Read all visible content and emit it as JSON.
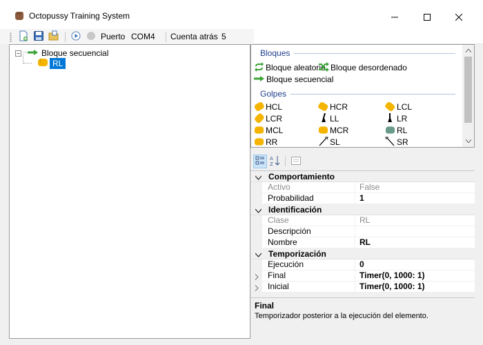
{
  "window": {
    "title": "Octopussy Training System",
    "minimize_glyph": "—",
    "maximize_glyph": "☐",
    "close_glyph": "✕"
  },
  "toolbar": {
    "new_icon": "new-document-icon",
    "save_icon": "save-icon",
    "open_icon": "open-folder-icon",
    "play_icon": "play-icon",
    "status_icon": "status-dot-icon",
    "port_label": "Puerto",
    "port_value": "COM4",
    "countdown_label": "Cuenta atrás",
    "countdown_value": "5"
  },
  "tree": {
    "root_expander": "−",
    "root_label": "Bloque secuencial",
    "child_label": "RL"
  },
  "toolbox": {
    "bloques_header": "Bloques",
    "bloques": [
      {
        "label": "Bloque aleatorio",
        "icon": "random-block-icon"
      },
      {
        "label": "Bloque desordenado",
        "icon": "shuffle-block-icon"
      },
      {
        "label": "Bloque secuencial",
        "icon": "sequence-block-icon"
      }
    ],
    "golpes_header": "Golpes",
    "golpes": [
      {
        "label": "HCL",
        "icon": "glove-icon"
      },
      {
        "label": "HCR",
        "icon": "glove-icon"
      },
      {
        "label": "LCL",
        "icon": "glove-icon"
      },
      {
        "label": "LCR",
        "icon": "glove-icon"
      },
      {
        "label": "LL",
        "icon": "leg-icon"
      },
      {
        "label": "LR",
        "icon": "leg-icon"
      },
      {
        "label": "MCL",
        "icon": "glove-icon"
      },
      {
        "label": "MCR",
        "icon": "glove-icon"
      },
      {
        "label": "RL",
        "icon": "glove-icon"
      },
      {
        "label": "RR",
        "icon": "glove-icon"
      },
      {
        "label": "SL",
        "icon": "stick-icon"
      },
      {
        "label": "SR",
        "icon": "stick-icon"
      }
    ]
  },
  "property_grid": {
    "categories": [
      {
        "label": "Comportamiento",
        "rows": [
          {
            "name": "Activo",
            "value": "False",
            "readonly": true
          },
          {
            "name": "Probabilidad",
            "value": "1",
            "readonly": false
          }
        ]
      },
      {
        "label": "Identificación",
        "rows": [
          {
            "name": "Clase",
            "value": "RL",
            "readonly": true
          },
          {
            "name": "Descripción",
            "value": "",
            "readonly": false
          },
          {
            "name": "Nombre",
            "value": "RL",
            "readonly": false
          }
        ]
      },
      {
        "label": "Temporización",
        "rows": [
          {
            "name": "Ejecución",
            "value": "0",
            "readonly": false
          },
          {
            "name": "Final",
            "value": "Timer(0, 1000: 1)",
            "readonly": false,
            "expandable": true
          },
          {
            "name": "Inicial",
            "value": "Timer(0, 1000: 1)",
            "readonly": false,
            "expandable": true
          }
        ]
      }
    ],
    "help_title": "Final",
    "help_description": "Temporizador posterior a la ejecución del elemento."
  },
  "colors": {
    "selection": "#0078d7",
    "group_header": "#1e3f8c",
    "glove": "#f4b400",
    "arrow_green": "#3aa335"
  }
}
